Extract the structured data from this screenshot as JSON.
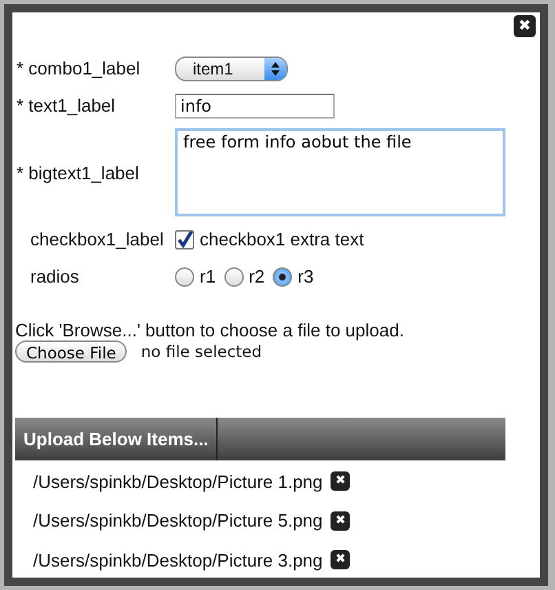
{
  "dialog": {
    "close": "✖"
  },
  "form": {
    "combo": {
      "label": "* combo1_label",
      "value": "item1"
    },
    "text": {
      "label": "* text1_label",
      "value": "info"
    },
    "bigtext": {
      "label": "* bigtext1_label",
      "value": "free form info aobut the file"
    },
    "checkbox": {
      "label": "checkbox1_label",
      "text": "checkbox1 extra text",
      "checked": true
    },
    "radios": {
      "label": "radios",
      "options": [
        {
          "label": "r1",
          "selected": false
        },
        {
          "label": "r2",
          "selected": false
        },
        {
          "label": "r3",
          "selected": true
        }
      ]
    }
  },
  "upload": {
    "instructions": "Click 'Browse...' button to choose a file to upload.",
    "button": "Choose File",
    "status": "no file selected"
  },
  "items": {
    "header": "Upload Below Items...",
    "files": [
      {
        "path": "/Users/spinkb/Desktop/Picture 1.png",
        "remove": "✖"
      },
      {
        "path": "/Users/spinkb/Desktop/Picture 5.png",
        "remove": "✖"
      },
      {
        "path": "/Users/spinkb/Desktop/Picture 3.png",
        "remove": "✖"
      }
    ]
  }
}
